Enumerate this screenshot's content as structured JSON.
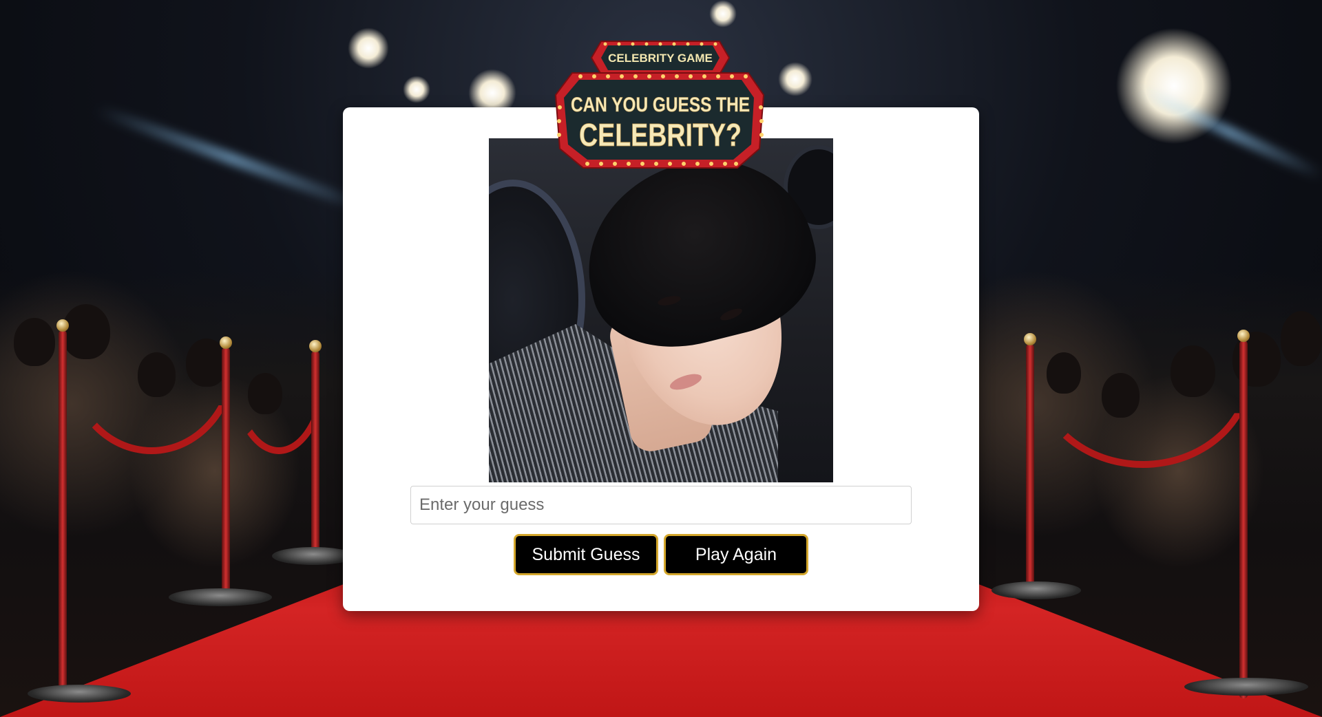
{
  "logo": {
    "banner_text": "CELEBRITY GAME",
    "title_line1": "CAN YOU GUESS THE",
    "title_line2": "CELEBRITY?"
  },
  "game": {
    "guess_placeholder": "Enter your guess",
    "guess_value": "",
    "submit_label": "Submit Guess",
    "play_again_label": "Play Again"
  },
  "colors": {
    "button_bg": "#000000",
    "button_border": "#d4a72c",
    "card_bg": "#ffffff",
    "carpet": "#c01616",
    "marquee_bulb": "#ffd36b"
  }
}
